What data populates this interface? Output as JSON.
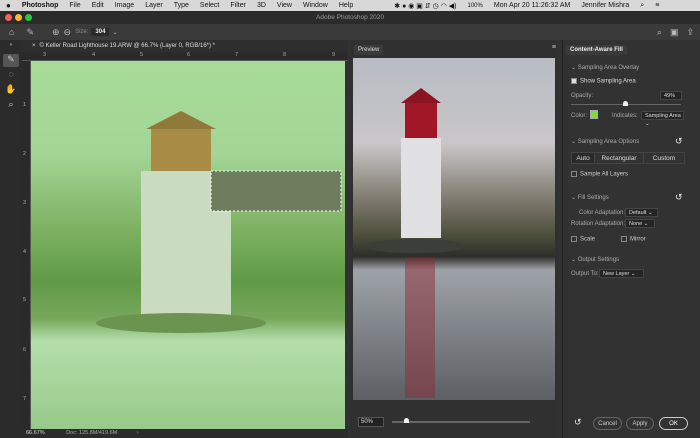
{
  "menubar": {
    "apple": "",
    "items": [
      "Photoshop",
      "File",
      "Edit",
      "Image",
      "Layer",
      "Type",
      "Select",
      "Filter",
      "3D",
      "View",
      "Window",
      "Help"
    ],
    "battery": "100%",
    "clock": "Mon Apr 20  11:26:32 AM",
    "user": "Jennifer Mishra"
  },
  "window": {
    "title": "Adobe Photoshop 2020"
  },
  "options": {
    "size_label": "Size:",
    "size_value": "304"
  },
  "document": {
    "tab": "© Keller Road Lighthouse 19.ARW @ 66.7% (Layer 0, RGB/16*) *",
    "zoom": "66.67%",
    "doc_info": "Doc: 125.8M/419.6M",
    "h_ruler": [
      "3",
      "4",
      "5",
      "6",
      "7",
      "8",
      "9"
    ],
    "v_ruler": [
      "1",
      "2",
      "3",
      "4",
      "5",
      "6",
      "7"
    ],
    "overlay_color": "#8fd27a"
  },
  "preview": {
    "title": "Preview",
    "zoom": "50%",
    "zoom_slider": 0.1
  },
  "caf": {
    "title": "Content-Aware Fill",
    "overlay_section": "Sampling Area Overlay",
    "show_sampling": "Show Sampling Area",
    "opacity_label": "Opacity:",
    "opacity": "49%",
    "opacity_fraction": 0.49,
    "color_label": "Color:",
    "color": "#7bdc3c",
    "indicates_label": "Indicates:",
    "indicates": "Sampling Area",
    "options_section": "Sampling Area Options",
    "modes": [
      "Auto",
      "Rectangular",
      "Custom"
    ],
    "sample_all": "Sample All Layers",
    "fill_section": "Fill Settings",
    "color_adapt_label": "Color Adaptation:",
    "color_adapt": "Default",
    "rot_adapt_label": "Rotation Adaptation:",
    "rot_adapt": "None",
    "scale": "Scale",
    "mirror": "Mirror",
    "output_section": "Output Settings",
    "output_label": "Output To:",
    "output": "New Layer",
    "cancel": "Cancel",
    "apply": "Apply",
    "ok": "OK"
  }
}
